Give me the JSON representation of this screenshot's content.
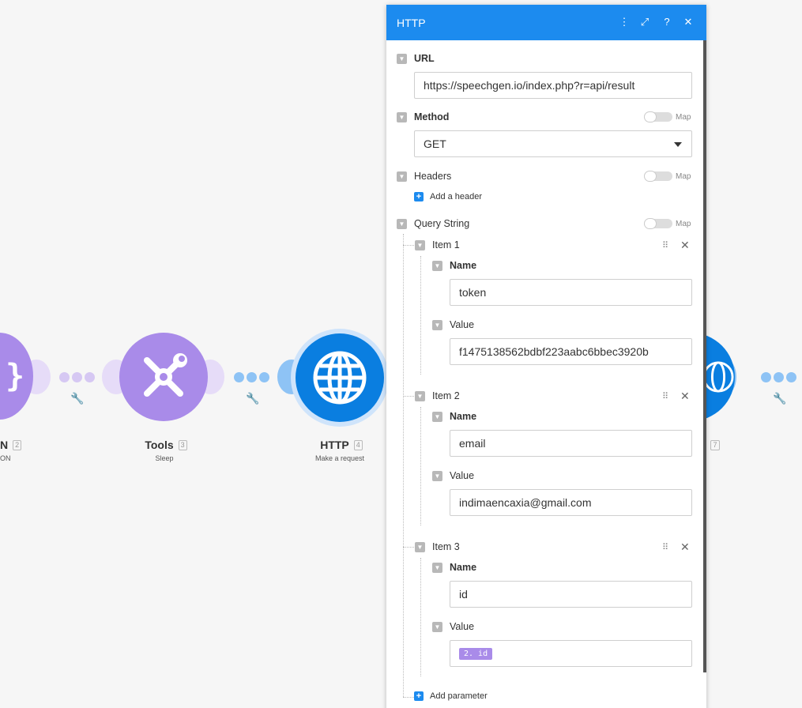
{
  "canvas": {
    "modules": [
      {
        "title": "N",
        "badge": "2",
        "subtitle": "ON"
      },
      {
        "title": "Tools",
        "badge": "3",
        "subtitle": "Sleep"
      },
      {
        "title": "HTTP",
        "badge": "4",
        "subtitle": "Make a request"
      },
      {
        "title": "",
        "badge": "7",
        "subtitle": ""
      }
    ],
    "icons": [
      "json-icon",
      "wrench-screwdriver-icon",
      "globe-icon",
      "globe-icon"
    ]
  },
  "panel": {
    "title": "HTTP",
    "header_icons": [
      "more-icon",
      "expand-icon",
      "help-icon",
      "close-icon"
    ],
    "url": {
      "label": "URL",
      "value": "https://speechgen.io/index.php?r=api/result"
    },
    "method": {
      "label": "Method",
      "map": "Map",
      "value": "GET"
    },
    "headers": {
      "label": "Headers",
      "map": "Map",
      "add": "Add a header"
    },
    "query": {
      "label": "Query String",
      "map": "Map",
      "items": [
        {
          "label": "Item 1",
          "name_label": "Name",
          "name": "token",
          "value_label": "Value",
          "value": "f1475138562bdbf223aabc6bbec3920b"
        },
        {
          "label": "Item 2",
          "name_label": "Name",
          "name": "email",
          "value_label": "Value",
          "value": "indimaencaxia@gmail.com"
        },
        {
          "label": "Item 3",
          "name_label": "Name",
          "name": "id",
          "value_label": "Value",
          "value": "2. id"
        }
      ],
      "add": "Add parameter"
    }
  },
  "colors": {
    "header": "#1c8bef",
    "http_module": "#0a7ee0",
    "tools_module": "#a98be9",
    "pill": "#a98be9"
  }
}
